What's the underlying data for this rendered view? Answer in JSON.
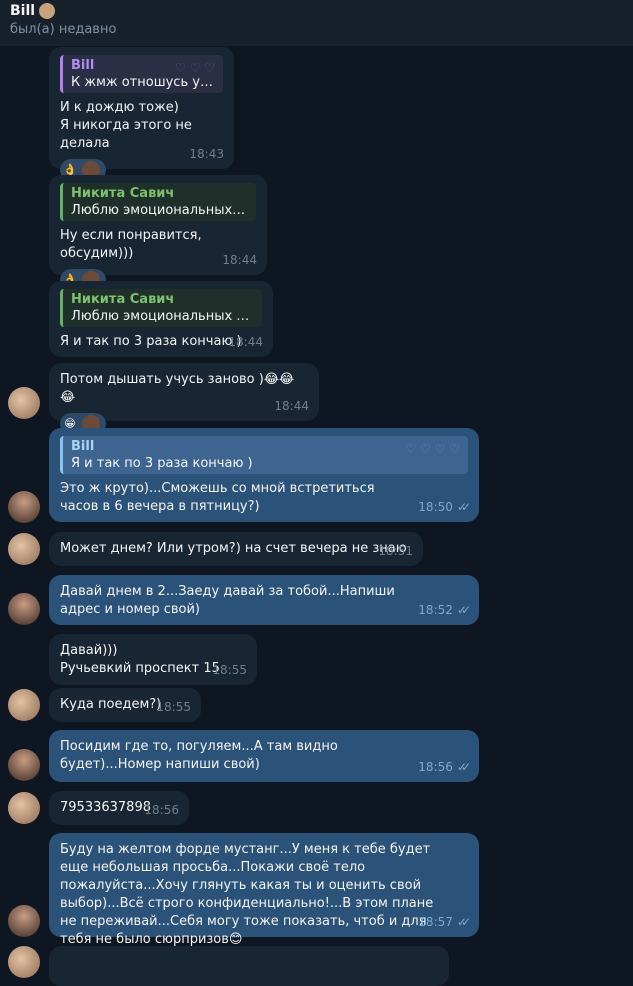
{
  "header": {
    "name": "Bill",
    "status": "был(а) недавно"
  },
  "messages": [
    {
      "quote_name": "Bill",
      "quote_text": "К жмж отношусь ужа...",
      "text": "И к дождю тоже)\nЯ никогда этого не делала",
      "time": "18:43",
      "reaction": "👌"
    },
    {
      "quote_name": "Никита Савич",
      "quote_text": "Люблю эмоциональных де...",
      "text": "Ну если понравится, обсудим)))",
      "time": "18:44",
      "reaction": "👌"
    },
    {
      "quote_name": "Никита Савич",
      "quote_text": "Люблю эмоциональных дев...",
      "text": "Я и так по 3 раза кончаю )",
      "time": "18:44"
    },
    {
      "text": "Потом дышать учусь заново )😂😂😂",
      "time": "18:44",
      "reaction": "😁"
    },
    {
      "quote_name": "Bill",
      "quote_text": "Я и так по 3 раза кончаю )",
      "text": "Это ж круто)...Сможешь со мной встретиться часов в 6 вечера в пятницу?)",
      "time": "18:50"
    },
    {
      "text": "Может днем? Или утром?) на счет вечера не знаю",
      "time": "18:51"
    },
    {
      "text": "Давай днем в 2...Заеду давай за тобой...Напиши адрес и номер свой)",
      "time": "18:52"
    },
    {
      "text": "Давай)))\nРучьевкий проспект 15",
      "time": "18:55"
    },
    {
      "text": "Куда поедем?)",
      "time": "18:55"
    },
    {
      "text": "Посидим где то, погуляем...А там видно будет)...Номер напиши свой)",
      "time": "18:56"
    },
    {
      "text": "79533637898",
      "time": "18:56"
    },
    {
      "text": "Буду на желтом форде мустанг...У меня к тебе будет еще небольшая просьба...Покажи своё тело пожалуйста...Хочу глянуть какая ты и оценить свой выбор)...Всё строго конфиденциально!...В этом плане не переживай...Себя могу тоже показать, чтоб и для тебя не было сюрпризов😊",
      "time": "18:57"
    }
  ]
}
